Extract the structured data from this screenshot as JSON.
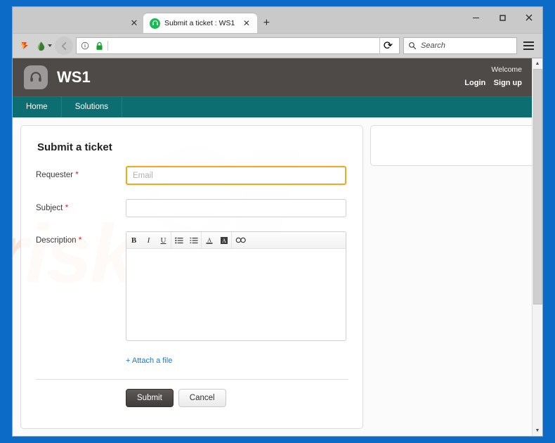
{
  "browser": {
    "window_controls": [
      {
        "name": "minimize",
        "glyph": "minimize-icon"
      },
      {
        "name": "maximize",
        "glyph": "maximize-icon"
      },
      {
        "name": "close",
        "glyph": "close-icon"
      }
    ],
    "tab": {
      "title": "Submit a ticket : WS1",
      "favicon": "headset-favicon",
      "close_glyph": "✕"
    },
    "left_tab_close_glyph": "✕",
    "new_tab_glyph": "+",
    "toolbar_icons": [
      "shortcut-s-icon",
      "extension-droplet-icon",
      "back-arrow-icon",
      "page-info-icon",
      "padlock-icon"
    ],
    "url": "",
    "reload_glyph": "⟳",
    "search_placeholder": "Search",
    "menu": "hamburger-menu"
  },
  "site": {
    "brand": "WS1",
    "logo": "headset-logo",
    "welcome": "Welcome",
    "auth": [
      {
        "label": "Login"
      },
      {
        "label": "Sign up"
      }
    ],
    "nav": [
      {
        "label": "Home"
      },
      {
        "label": "Solutions"
      }
    ],
    "header_bg": "#4d4a48",
    "nav_bg": "#0c6e70"
  },
  "form": {
    "title": "Submit a ticket",
    "required_mark": "*",
    "fields": [
      {
        "label": "Requester",
        "required": true,
        "placeholder": "Email",
        "value": "",
        "focused": true
      },
      {
        "label": "Subject",
        "required": true,
        "placeholder": "",
        "value": "",
        "focused": false
      },
      {
        "label": "Description",
        "required": true,
        "placeholder": "",
        "value": "",
        "focused": false
      }
    ],
    "editor_tools": [
      {
        "name": "bold-icon",
        "glyph": "B"
      },
      {
        "name": "italic-icon",
        "glyph": "I"
      },
      {
        "name": "underline-icon",
        "glyph": "U"
      },
      {
        "name": "bullet-list-icon",
        "glyph": "☰"
      },
      {
        "name": "numbered-list-icon",
        "glyph": "☰"
      },
      {
        "name": "font-color-icon",
        "glyph": "A"
      },
      {
        "name": "highlight-color-icon",
        "glyph": "A"
      },
      {
        "name": "insert-link-icon",
        "glyph": "∞"
      }
    ],
    "attach_label": "+ Attach a file",
    "submit_label": "Submit",
    "cancel_label": "Cancel",
    "accent_focus": "#f0a826",
    "link_color": "#2277cc"
  },
  "sidebar": {
    "panel_empty": ""
  },
  "watermark": {
    "text": "risk.com",
    "color": "#f6a98a"
  }
}
